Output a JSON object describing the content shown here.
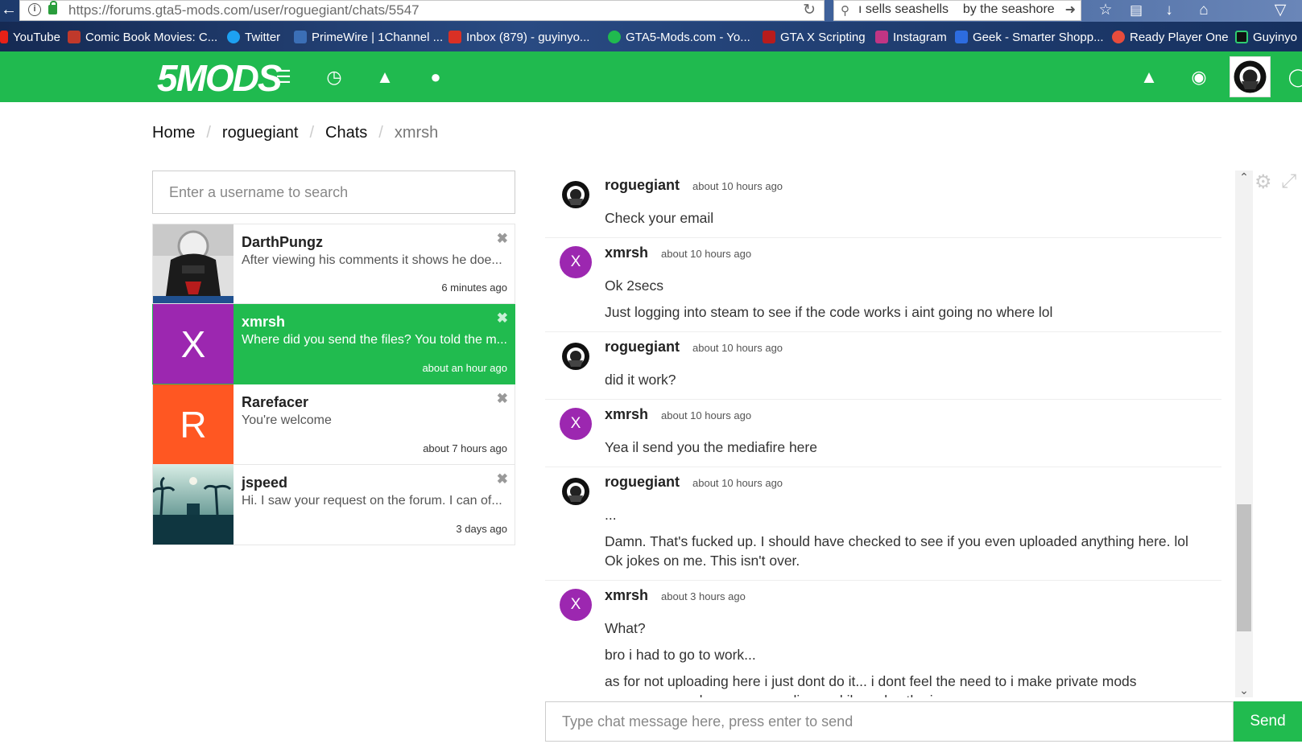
{
  "browser": {
    "url": "https://forums.gta5-mods.com/user/roguegiant/chats/5547",
    "search_query": "ı sells seashells    by the seashore"
  },
  "bookmarks": [
    {
      "label": "YouTube",
      "color": "#e62117"
    },
    {
      "label": "Comic Book Movies: C...",
      "color": "#c0392b"
    },
    {
      "label": "Twitter",
      "color": "#1da1f2"
    },
    {
      "label": "PrimeWire | 1Channel ...",
      "color": "#3b6fb6"
    },
    {
      "label": "Inbox (879) - guyinyo...",
      "color": "#d93025"
    },
    {
      "label": "GTA5-Mods.com - Yo...",
      "color": "#20ba4f"
    },
    {
      "label": "GTA X Scripting",
      "color": "#b71c1c"
    },
    {
      "label": "Instagram",
      "color": "#c13584"
    },
    {
      "label": "Geek - Smarter Shopp...",
      "color": "#2d6cdf"
    },
    {
      "label": "Ready Player One",
      "color": "#e74c3c"
    },
    {
      "label": "Guyinyo",
      "color": "#111111"
    }
  ],
  "site": {
    "logo_text": "5MODS",
    "brand_color": "#20ba4f"
  },
  "breadcrumb": {
    "home": "Home",
    "user": "roguegiant",
    "chats": "Chats",
    "current": "xmrsh"
  },
  "user_search": {
    "placeholder": "Enter a username to search"
  },
  "conversations": [
    {
      "name": "DarthPungz",
      "preview": "After viewing his comments it shows he doe...",
      "time": "6 minutes ago",
      "avatar": "image",
      "active": false
    },
    {
      "name": "xmrsh",
      "preview": "Where did you send the files? You told the m...",
      "time": "about an hour ago",
      "avatar_letter": "X",
      "avatar_color": "#9c27b0",
      "active": true
    },
    {
      "name": "Rarefacer",
      "preview": "You're welcome",
      "time": "about 7 hours ago",
      "avatar_letter": "R",
      "avatar_color": "#ff5722",
      "active": false
    },
    {
      "name": "jspeed",
      "preview": "Hi. I saw your request on the forum. I can of...",
      "time": "3 days ago",
      "avatar": "image",
      "active": false
    }
  ],
  "messages": [
    {
      "author": "roguegiant",
      "time": "about 10 hours ago",
      "avatar": "darth",
      "lines": [
        "Check your email"
      ]
    },
    {
      "author": "xmrsh",
      "time": "about 10 hours ago",
      "avatar": "X",
      "lines": [
        "Ok 2secs",
        "Just logging into steam to see if the code works i aint going no where lol"
      ]
    },
    {
      "author": "roguegiant",
      "time": "about 10 hours ago",
      "avatar": "darth",
      "lines": [
        "did it work?"
      ]
    },
    {
      "author": "xmrsh",
      "time": "about 10 hours ago",
      "avatar": "X",
      "lines": [
        "Yea il send you the mediafire here"
      ]
    },
    {
      "author": "roguegiant",
      "time": "about 10 hours ago",
      "avatar": "darth",
      "lines": [
        "...",
        "Damn. That's fucked up. I should have checked to see if you even uploaded anything here. lol Ok jokes on me. This isn't over."
      ]
    },
    {
      "author": "xmrsh",
      "time": "about 3 hours ago",
      "avatar": "X",
      "lines": [
        "What?",
        "bro i had to go to work...",
        "as for not uploading here i just dont do it... i dont feel the need to i make private mods message me when you are online and il resolve the issue"
      ]
    }
  ],
  "chat_input": {
    "placeholder": "Type chat message here, press enter to send",
    "send_label": "Send"
  },
  "colors": {
    "avatar_x": "#9c27b0",
    "avatar_r": "#ff5722",
    "active_conv": "#21bb4f"
  }
}
